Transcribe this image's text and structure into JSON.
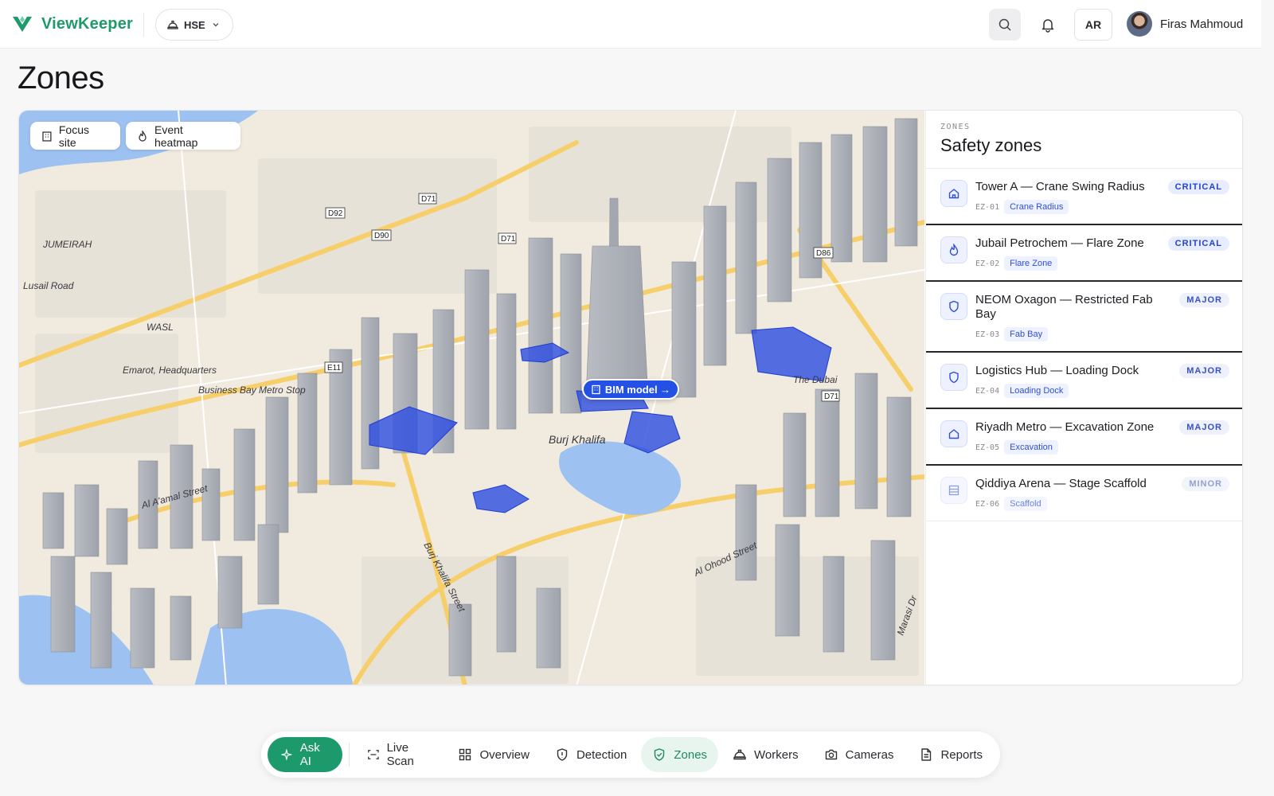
{
  "app": {
    "name": "ViewKeeper",
    "org": "HSE",
    "language": "AR",
    "user_name": "Firas Mahmoud"
  },
  "page": {
    "title": "Zones"
  },
  "map": {
    "focus_label": "Focus site",
    "heatmap_label": "Event heatmap",
    "bim_label": "BIM model →",
    "labels": [
      "Emarot, Headquarters",
      "Business Bay Metro Stop",
      "Burj Khalifa",
      "Al A'amal Street",
      "Burj Khalifa Street",
      "Al Ohood Street",
      "The Dubai",
      "Marasi Dr",
      "WASL",
      "JUMEIRAH",
      "Lusail Road"
    ],
    "road_codes": [
      "D71",
      "D90",
      "D92",
      "D86",
      "E11",
      "D71",
      "D71"
    ]
  },
  "panel": {
    "kicker": "ZONES",
    "title": "Safety zones",
    "zones": [
      {
        "name": "Tower A — Crane Swing Radius",
        "code": "EZ-01",
        "tag": "Crane Radius",
        "severity": "CRITICAL",
        "icon": "home-icon"
      },
      {
        "name": "Jubail Petrochem — Flare Zone",
        "code": "EZ-02",
        "tag": "Flare Zone",
        "severity": "CRITICAL",
        "icon": "flame-icon"
      },
      {
        "name": "NEOM Oxagon — Restricted Fab Bay",
        "code": "EZ-03",
        "tag": "Fab Bay",
        "severity": "MAJOR",
        "icon": "shield-icon"
      },
      {
        "name": "Logistics Hub — Loading Dock",
        "code": "EZ-04",
        "tag": "Loading Dock",
        "severity": "MAJOR",
        "icon": "shield-icon"
      },
      {
        "name": "Riyadh Metro — Excavation Zone",
        "code": "EZ-05",
        "tag": "Excavation",
        "severity": "MAJOR",
        "icon": "home-icon"
      },
      {
        "name": "Qiddiya Arena — Stage Scaffold",
        "code": "EZ-06",
        "tag": "Scaffold",
        "severity": "MINOR",
        "icon": "scaffold-icon"
      }
    ]
  },
  "nav": {
    "ask_ai": "Ask AI",
    "live_scan": "Live Scan",
    "overview": "Overview",
    "detection": "Detection",
    "zones": "Zones",
    "workers": "Workers",
    "cameras": "Cameras",
    "reports": "Reports"
  },
  "colors": {
    "brand": "#1f9a6b",
    "accent": "#2450e6",
    "zone_fill": "#2f4fe0"
  }
}
